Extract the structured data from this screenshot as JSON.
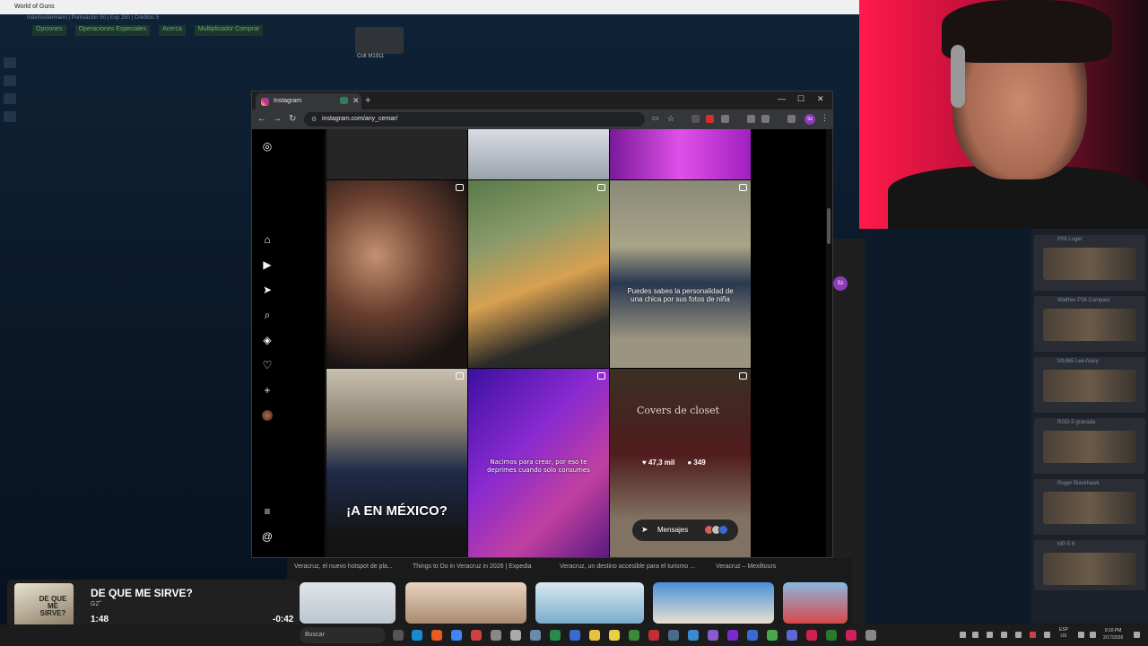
{
  "game": {
    "title": "World of Guns",
    "stats": "maxmustermann | Puntuación 50 | Exp 250 | Créditos 5",
    "menu": [
      "Opciones",
      "Operaciones Especiales",
      "Acerca",
      "Multiplicador Comprar"
    ],
    "gun_label": "Colt M1911",
    "weapons": [
      "P08 Luger",
      "Walther P38 Compact",
      "M1865 Lee-Navy",
      "RGD-5 granada",
      "Ruger Blackhawk",
      "MP-5 K"
    ]
  },
  "browser": {
    "tab_title": "Instagram",
    "url": "instagram.com/any_cemar/",
    "profile_initials": "Sz"
  },
  "instagram": {
    "sidebar_icons": [
      "instagram-logo-icon",
      "home-icon",
      "reels-icon",
      "direct-icon",
      "search-icon",
      "explore-icon",
      "heart-icon",
      "plus-icon",
      "profile-avatar"
    ],
    "posts": [
      {
        "caption": ""
      },
      {
        "caption": ""
      },
      {
        "caption": "Puedes sabes la personalidad de una chica por sus fotos de niña"
      },
      {
        "caption": "¡A EN MÉXICO?"
      },
      {
        "caption": "Nacimos para crear, por eso te deprimes cuando solo consumes"
      },
      {
        "caption": "Covers de closet",
        "likes": "47,3 mil",
        "comments": "349"
      }
    ],
    "messages_label": "Mensajes"
  },
  "bg_window": {
    "profile_initials": "Sz"
  },
  "search_results": [
    "Veracruz, el nuevo hotspot de pla...",
    "Things to Do in Veracruz in 2026 | Expedia",
    "Veracruz, un destino accesible para el turismo ...",
    "Veracruz – Mexiltours"
  ],
  "player": {
    "title": "DE QUE ME SIRVE?",
    "artist": "GZ˜",
    "album_text": "DE QUE ME SIRVE?",
    "elapsed": "1:48",
    "remaining": "-0:42",
    "progress": 0.72
  },
  "taskbar": {
    "search_label": "Buscar",
    "lang": "ESP\nUS",
    "time": "9:10 PM",
    "date": "2/17/2026"
  },
  "colors": {
    "accent": "#8e3bb8",
    "instagram": "#d62976"
  }
}
